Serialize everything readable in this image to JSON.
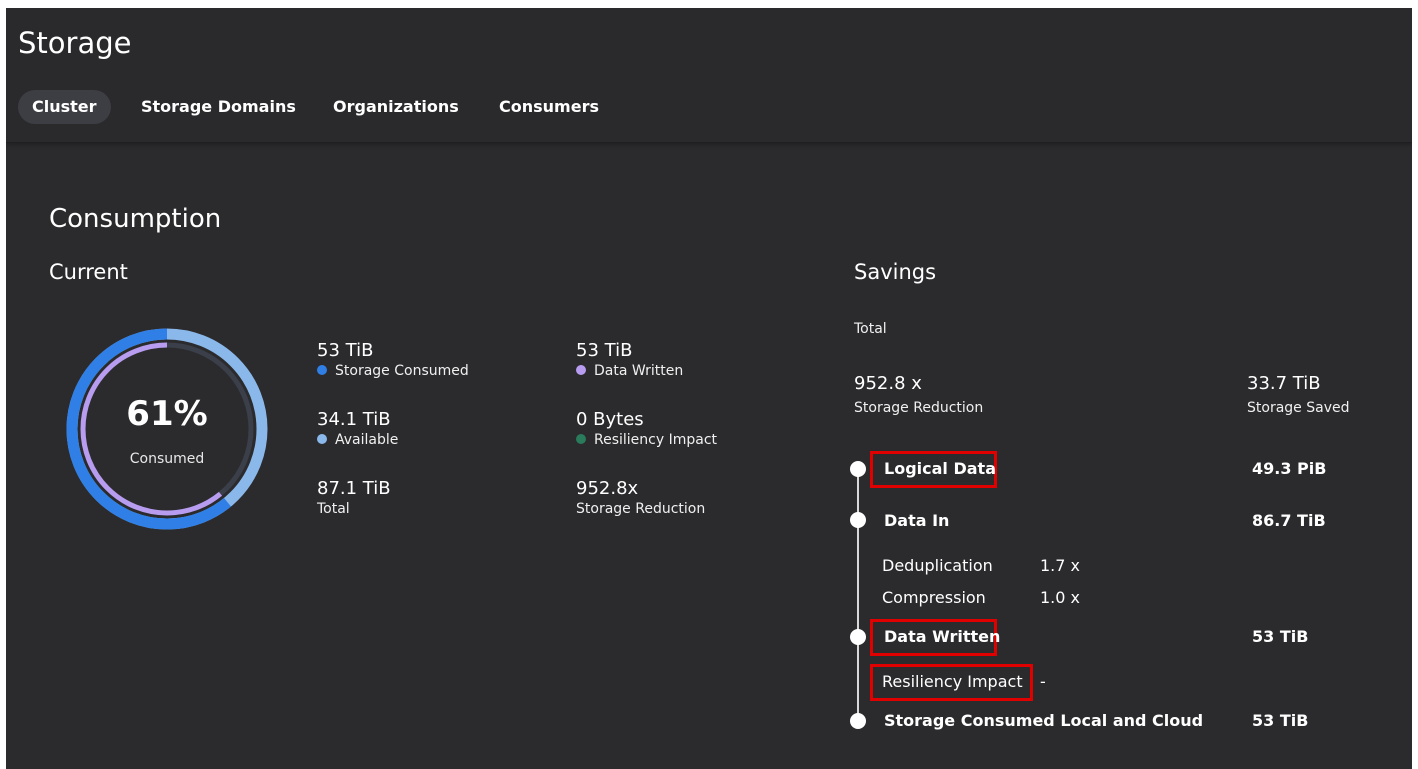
{
  "header": {
    "title": "Storage",
    "tabs": [
      {
        "label": "Cluster",
        "active": true
      },
      {
        "label": "Storage Domains",
        "active": false
      },
      {
        "label": "Organizations",
        "active": false
      },
      {
        "label": "Consumers",
        "active": false
      }
    ]
  },
  "consumption": {
    "title": "Consumption",
    "current": {
      "title": "Current",
      "donut": {
        "percent_text": "61%",
        "label": "Consumed",
        "consumed_fraction": 0.61,
        "written_fraction": 0.61
      },
      "stats": [
        {
          "value": "53 TiB",
          "label": "Storage Consumed",
          "dot_color": "#2f7fe6"
        },
        {
          "value": "53 TiB",
          "label": "Data Written",
          "dot_color": "#b79cf0"
        },
        {
          "value": "34.1 TiB",
          "label": "Available",
          "dot_color": "#8bb8ea"
        },
        {
          "value": "0 Bytes",
          "label": "Resiliency Impact",
          "dot_color": "#2a7a5c"
        },
        {
          "value": "87.1 TiB",
          "label": "Total"
        },
        {
          "value": "952.8x",
          "label": "Storage Reduction"
        }
      ]
    },
    "savings": {
      "title": "Savings",
      "total_label": "Total",
      "reduction_value": "952.8 x",
      "reduction_label": "Storage Reduction",
      "saved_value": "33.7 TiB",
      "saved_label": "Storage Saved",
      "timeline": {
        "logical_data": {
          "label": "Logical Data",
          "value": "49.3 PiB"
        },
        "data_in": {
          "label": "Data In",
          "value": "86.7 TiB"
        },
        "deduplication": {
          "label": "Deduplication",
          "value": "1.7 x"
        },
        "compression": {
          "label": "Compression",
          "value": "1.0 x"
        },
        "data_written": {
          "label": "Data Written",
          "value": "53 TiB"
        },
        "resiliency_impact": {
          "label": "Resiliency Impact",
          "value": "-"
        },
        "storage_consumed": {
          "label": "Storage Consumed Local and Cloud",
          "value": "53 TiB"
        }
      }
    }
  },
  "colors": {
    "background": "#2b2b2e",
    "consumed_blue": "#2f7fe6",
    "available_blue": "#8bb8ea",
    "written_purple": "#b79cf0",
    "resiliency_green": "#2a7a5c",
    "highlight_red": "#e00000"
  }
}
